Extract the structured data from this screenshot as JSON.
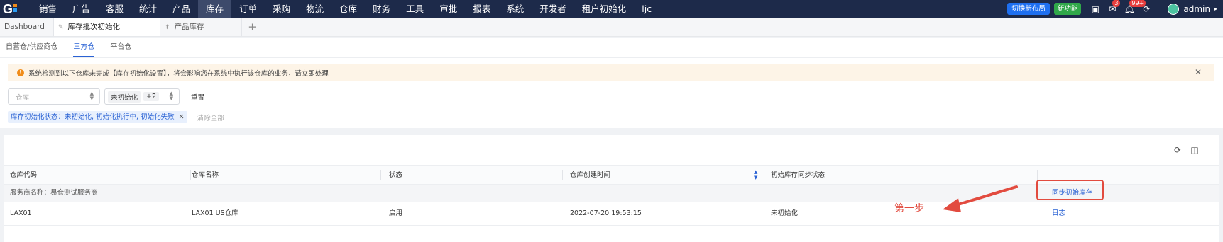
{
  "topnav": {
    "items": [
      "销售",
      "广告",
      "客服",
      "统计",
      "产品",
      "库存",
      "订单",
      "采购",
      "物流",
      "仓库",
      "财务",
      "工具",
      "审批",
      "报表",
      "系统",
      "开发者",
      "租户初始化",
      "ljc"
    ],
    "active_index": 5,
    "switch_layout_label": "切换新布局",
    "new_feature_label": "新功能",
    "notice_badge": "3",
    "msg_badge": "99+",
    "user": "admin",
    "colors": {
      "bar": "#1d2a4a",
      "switch_btn": "#1e6ff0",
      "new_feature": "#30a84a"
    }
  },
  "tabs": [
    {
      "label": "Dashboard"
    },
    {
      "label": "库存批次初始化"
    },
    {
      "label": "产品库存"
    }
  ],
  "subtabs": [
    "自营仓/供应商仓",
    "三方仓",
    "平台仓"
  ],
  "alert": {
    "text": "系统检测到以下仓库未完成【库存初始化设置】，将会影响您在系统中执行该仓库的业务，请立即处理"
  },
  "filters": {
    "warehouse_placeholder": "仓库",
    "status_tag": "未初始化",
    "status_more": "+2",
    "reset_label": "重置"
  },
  "chips": {
    "status_chip": "库存初始化状态：未初始化, 初始化执行中, 初始化失败",
    "clear_all": "清除全部"
  },
  "table": {
    "columns": [
      "仓库代码",
      "仓库名称",
      "状态",
      "仓库创建时间",
      "初始库存同步状态"
    ],
    "group_label": "服务商名称：易仓测试服务商",
    "group_action": "同步初始库存",
    "rows": [
      {
        "code": "LAX01",
        "name": "LAX01 US仓库",
        "status": "启用",
        "created": "2022-07-20 19:53:15",
        "sync_status": "未初始化",
        "action": "日志"
      }
    ]
  },
  "annotation": {
    "label": "第一步",
    "color": "#e24b3f"
  }
}
